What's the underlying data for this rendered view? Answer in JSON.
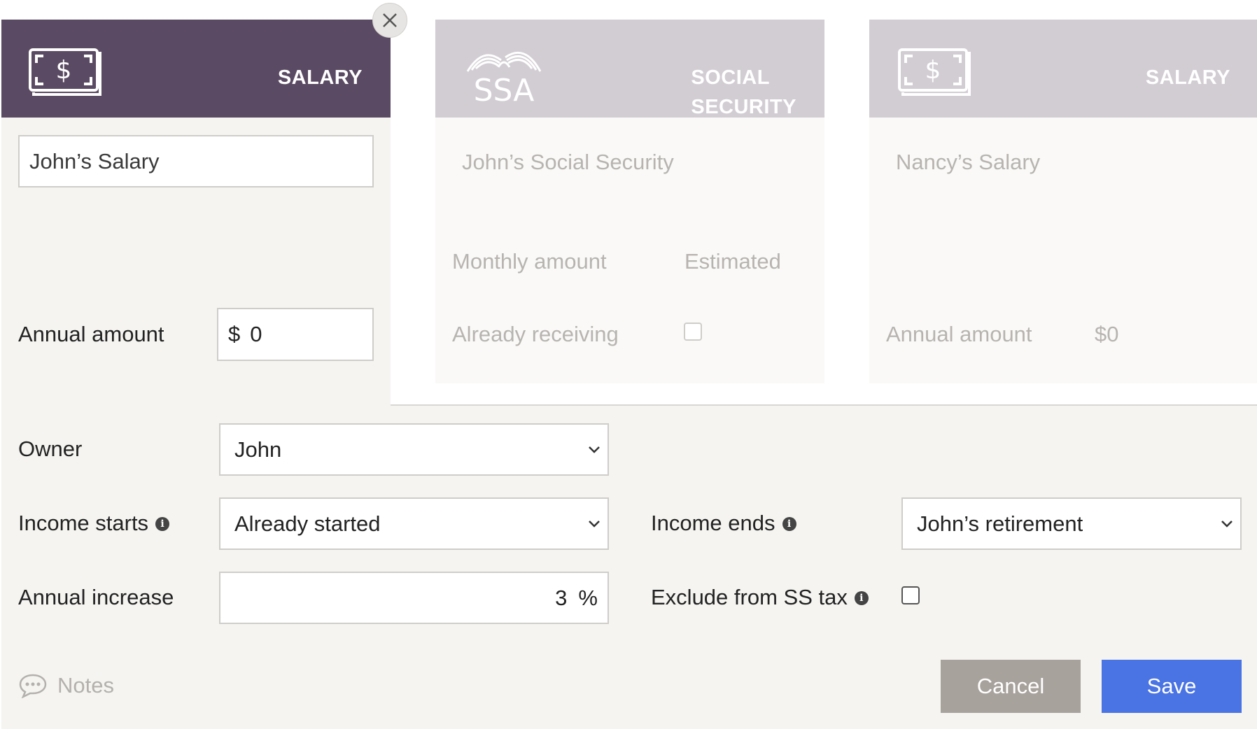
{
  "active_card": {
    "type_label": "SALARY",
    "icon": "dollar-bill-icon",
    "name_value": "John’s Salary",
    "annual_amount_label": "Annual amount",
    "currency_prefix": "$",
    "annual_amount_value": "0"
  },
  "close_icon": "close-icon",
  "other_cards": [
    {
      "type_label_line1": "SOCIAL",
      "type_label_line2": "SECURITY",
      "logo_text": "SSA",
      "name": "John’s Social Security",
      "monthly_amount_label": "Monthly amount",
      "monthly_amount_value": "Estimated",
      "already_receiving_label": "Already receiving",
      "already_receiving_checked": false
    },
    {
      "type_label": "SALARY",
      "icon": "dollar-bill-icon",
      "name": "Nancy’s Salary",
      "annual_amount_label": "Annual amount",
      "annual_amount_value": "$0"
    }
  ],
  "form": {
    "owner_label": "Owner",
    "owner_value": "John",
    "income_starts_label": "Income starts",
    "income_starts_value": "Already started",
    "income_ends_label": "Income ends",
    "income_ends_value": "John’s retirement",
    "annual_increase_label": "Annual increase",
    "annual_increase_value": "3",
    "annual_increase_unit": "%",
    "exclude_ss_tax_label": "Exclude from SS tax",
    "exclude_ss_tax_checked": false,
    "info_icon": "i"
  },
  "footer": {
    "notes_label": "Notes",
    "cancel_label": "Cancel",
    "save_label": "Save"
  },
  "colors": {
    "active_header": "#5b4a63",
    "inactive_header": "#d2cdd3",
    "save_button": "#4a73e3",
    "cancel_button": "#a8a29d"
  }
}
